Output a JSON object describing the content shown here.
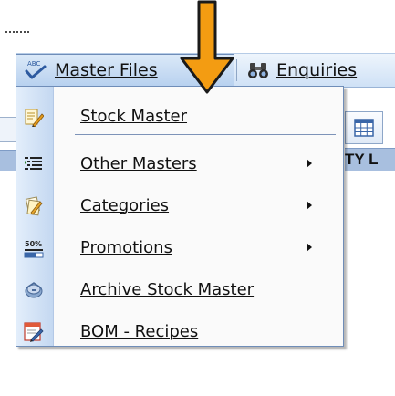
{
  "menubar": {
    "master_files": {
      "label": "Master Files",
      "icon": "spelling-abc-icon"
    },
    "enquiries": {
      "label": "Enquiries",
      "icon": "binoculars-icon"
    }
  },
  "background": {
    "right_strip_text": "TY L"
  },
  "dropdown": {
    "items": [
      {
        "label": "Stock Master",
        "icon": "notepad-pencil-icon",
        "submenu": false
      },
      {
        "label": "Other Masters",
        "icon": "list-indent-icon",
        "submenu": true
      },
      {
        "label": "Categories",
        "icon": "notes-pencil-icon",
        "submenu": true
      },
      {
        "label": "Promotions",
        "icon": "percent-50-icon",
        "submenu": true
      },
      {
        "label": "Archive Stock Master",
        "icon": "archive-icon",
        "submenu": false
      },
      {
        "label": "BOM - Recipes",
        "icon": "document-edit-icon",
        "submenu": false
      }
    ]
  },
  "annotation": {
    "arrow_color": "#f39c12",
    "arrow_outline": "#1a1a1a"
  },
  "colors": {
    "menubar_top": "#eef5fc",
    "menubar_bottom": "#cfe1f6",
    "menu_border": "#6f8db8",
    "icon_column": "#c4d8f1"
  }
}
